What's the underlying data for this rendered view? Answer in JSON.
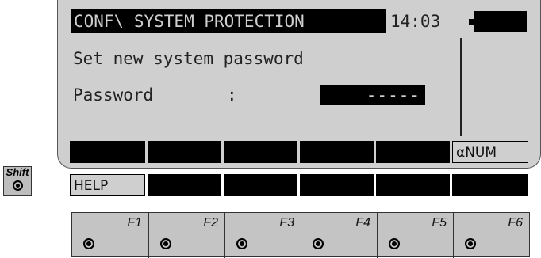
{
  "screen": {
    "title": "CONF\\ SYSTEM PROTECTION",
    "time": "14:03",
    "prompt": "Set new system password",
    "password_label": "Password",
    "password_separator": ":",
    "password_value": "-----"
  },
  "softkeys": [
    "",
    "",
    "",
    "",
    "",
    "αNUM"
  ],
  "shift_row": [
    "HELP",
    "",
    "",
    "",
    "",
    ""
  ],
  "shift_key_label": "Shift",
  "function_keys": [
    "F1",
    "F2",
    "F3",
    "F4",
    "F5",
    "F6"
  ],
  "colors": {
    "lcd": "#cfcfcf",
    "ink": "#000000",
    "keypad": "#c4c4c4"
  }
}
